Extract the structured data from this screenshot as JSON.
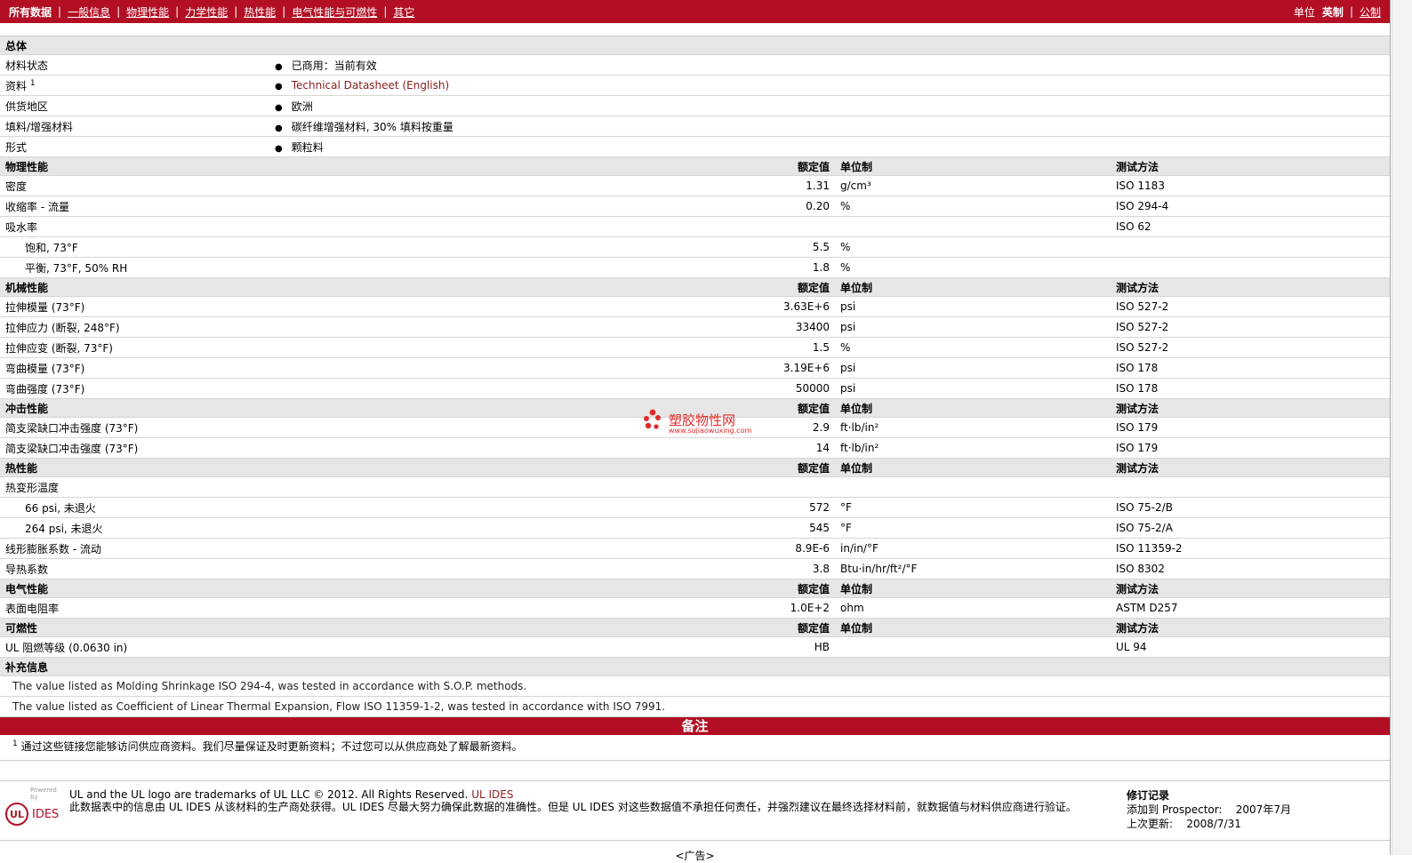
{
  "nav": {
    "items": [
      "所有数据",
      "一般信息",
      "物理性能",
      "力学性能",
      "热性能",
      "电气性能与可燃性",
      "其它"
    ],
    "unit_label": "单位",
    "unit_options": [
      "英制",
      "公制"
    ]
  },
  "headers": {
    "value": "额定值",
    "unit": "单位制",
    "method": "测试方法"
  },
  "general": {
    "title": "总体",
    "rows": [
      {
        "label": "材料状态",
        "value": "已商用：当前有效"
      },
      {
        "label": "资料",
        "sup": "1",
        "value": "Technical Datasheet (English)"
      },
      {
        "label": "供货地区",
        "value": "欧洲"
      },
      {
        "label": "填料/增强材料",
        "value": "碳纤维增强材料, 30% 填料按重量"
      },
      {
        "label": "形式",
        "value": "颗粒料"
      }
    ]
  },
  "sections": [
    {
      "title": "物理性能",
      "rows": [
        {
          "label": "密度",
          "value": "1.31",
          "unit": "g/cm³",
          "method": "ISO 1183"
        },
        {
          "label": "收缩率 - 流量",
          "value": "0.20",
          "unit": "%",
          "method": "ISO 294-4"
        },
        {
          "label": "吸水率",
          "value": "",
          "unit": "",
          "method": "ISO 62"
        },
        {
          "label": "饱和, 73°F",
          "indent": true,
          "value": "5.5",
          "unit": "%",
          "method": ""
        },
        {
          "label": "平衡, 73°F, 50% RH",
          "indent": true,
          "value": "1.8",
          "unit": "%",
          "method": ""
        }
      ]
    },
    {
      "title": "机械性能",
      "rows": [
        {
          "label": "拉伸模量 (73°F)",
          "value": "3.63E+6",
          "unit": "psi",
          "method": "ISO 527-2"
        },
        {
          "label": "拉伸应力 (断裂, 248°F)",
          "value": "33400",
          "unit": "psi",
          "method": "ISO 527-2"
        },
        {
          "label": "拉伸应变 (断裂, 73°F)",
          "value": "1.5",
          "unit": "%",
          "method": "ISO 527-2"
        },
        {
          "label": "弯曲模量 (73°F)",
          "value": "3.19E+6",
          "unit": "psi",
          "method": "ISO 178"
        },
        {
          "label": "弯曲强度 (73°F)",
          "value": "50000",
          "unit": "psi",
          "method": "ISO 178"
        }
      ]
    },
    {
      "title": "冲击性能",
      "rows": [
        {
          "label": "简支梁缺口冲击强度 (73°F)",
          "value": "2.9",
          "unit": "ft·lb/in²",
          "method": "ISO 179"
        },
        {
          "label": "简支梁缺口冲击强度 (73°F)",
          "value": "14",
          "unit": "ft·lb/in²",
          "method": "ISO 179"
        }
      ]
    },
    {
      "title": "热性能",
      "rows": [
        {
          "label": "热变形温度",
          "value": "",
          "unit": "",
          "method": ""
        },
        {
          "label": "66 psi, 未退火",
          "indent": true,
          "value": "572",
          "unit": "°F",
          "method": "ISO 75-2/B"
        },
        {
          "label": "264 psi, 未退火",
          "indent": true,
          "value": "545",
          "unit": "°F",
          "method": "ISO 75-2/A"
        },
        {
          "label": "线形膨胀系数 - 流动",
          "value": "8.9E-6",
          "unit": "in/in/°F",
          "method": "ISO 11359-2"
        },
        {
          "label": "导热系数",
          "value": "3.8",
          "unit": "Btu·in/hr/ft²/°F",
          "method": "ISO 8302"
        }
      ]
    },
    {
      "title": "电气性能",
      "rows": [
        {
          "label": "表面电阻率",
          "value": "1.0E+2",
          "unit": "ohm",
          "method": "ASTM D257"
        }
      ]
    },
    {
      "title": "可燃性",
      "rows": [
        {
          "label": "UL 阻燃等级 (0.0630 in)",
          "value": "HB",
          "unit": "",
          "method": "UL 94"
        }
      ]
    }
  ],
  "supplement": {
    "title": "补充信息",
    "notes": [
      "The value listed as Molding Shrinkage ISO 294-4, was tested in accordance with S.O.P. methods.",
      "The value listed as Coefficient of Linear Thermal Expansion, Flow ISO 11359-1-2, was tested in accordance with ISO 7991."
    ]
  },
  "remarks": {
    "title": "备注",
    "footnote_num": "1",
    "footnote": "通过这些链接您能够访问供应商资料。我们尽量保证及时更新资料；不过您可以从供应商处了解最新资料。"
  },
  "footer": {
    "powered": "Powered by",
    "logo_ul": "UL",
    "logo_ides": "IDES",
    "trademark": "UL and the UL logo are trademarks of UL LLC © 2012. All Rights Reserved.",
    "trademark_link": "UL IDES",
    "disclaimer": "此数据表中的信息由 UL IDES 从该材料的生产商处获得。UL IDES 尽最大努力确保此数据的准确性。但是 UL IDES 对这些数据值不承担任何责任，并强烈建议在最终选择材料前，就数据值与材料供应商进行验证。",
    "revision_title": "修订记录",
    "added_label": "添加到 Prospector:",
    "added_value": "2007年7月",
    "updated_label": "上次更新:",
    "updated_value": "2008/7/31",
    "ad": "<广告>"
  },
  "watermark": {
    "title": "塑胶物性网",
    "url": "www.sujiaowuxing.com"
  },
  "colors": {
    "brand": "#b20f24",
    "section_bg": "#e6e6e6",
    "link": "#8a1c1c"
  }
}
